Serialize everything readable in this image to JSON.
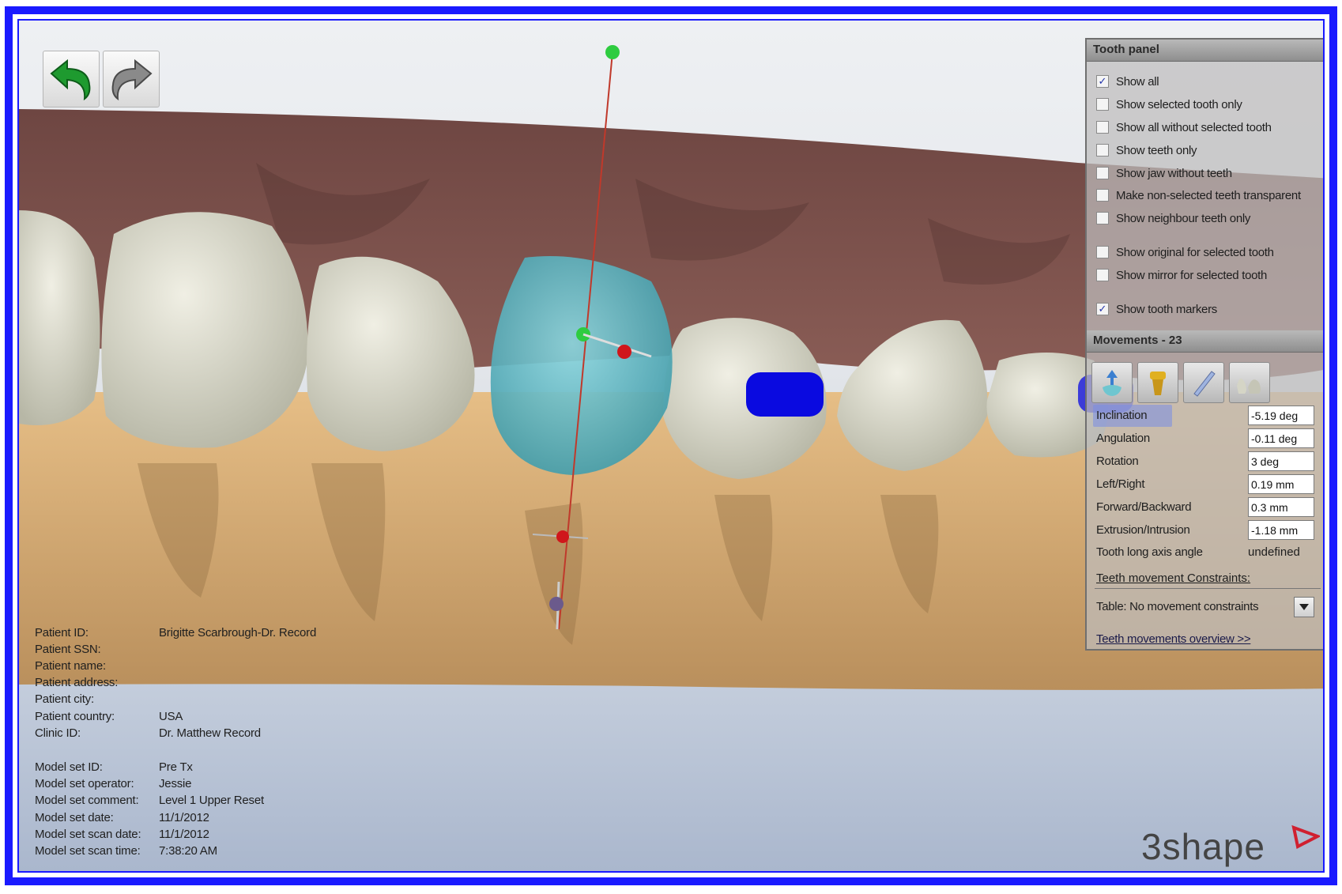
{
  "toolbar": {
    "undo_icon": "undo-arrow-icon",
    "redo_icon": "redo-arrow-icon"
  },
  "tooth_panel": {
    "title": "Tooth panel",
    "options": [
      {
        "label": "Show all",
        "checked": true
      },
      {
        "label": "Show selected tooth only",
        "checked": false
      },
      {
        "label": "Show all without selected tooth",
        "checked": false
      },
      {
        "label": "Show teeth only",
        "checked": false
      },
      {
        "label": "Show jaw without teeth",
        "checked": false
      },
      {
        "label": "Make non-selected teeth transparent",
        "checked": false
      },
      {
        "label": "Show neighbour teeth only",
        "checked": false
      },
      {
        "label": "Show original for selected tooth",
        "checked": false
      },
      {
        "label": "Show mirror for selected tooth",
        "checked": false
      },
      {
        "label": "Show tooth markers",
        "checked": true
      }
    ],
    "check_mark": "✓"
  },
  "movements": {
    "title": "Movements - 23",
    "tools": [
      "move-tooth-icon",
      "implant-icon",
      "ruler-icon",
      "teeth-icon"
    ],
    "fields": [
      {
        "label": "Inclination",
        "value": "-5.19 deg"
      },
      {
        "label": "Angulation",
        "value": "-0.11 deg"
      },
      {
        "label": "Rotation",
        "value": "3 deg"
      },
      {
        "label": "Left/Right",
        "value": "0.19 mm"
      },
      {
        "label": "Forward/Backward",
        "value": "0.3 mm"
      },
      {
        "label": "Extrusion/Intrusion",
        "value": "-1.18 mm"
      }
    ],
    "long_axis_label": "Tooth long axis angle",
    "long_axis_value": "undefined",
    "constraints_label": "Teeth movement Constraints:",
    "constraints_table": "Table: No movement constraints",
    "overview_link": "Teeth movements overview >>"
  },
  "patient_info": {
    "rows": [
      {
        "label": "Patient ID:",
        "value": "Brigitte Scarbrough-Dr. Record"
      },
      {
        "label": "Patient SSN:",
        "value": ""
      },
      {
        "label": "Patient name:",
        "value": ""
      },
      {
        "label": "Patient address:",
        "value": ""
      },
      {
        "label": "Patient city:",
        "value": ""
      },
      {
        "label": "Patient country:",
        "value": "USA"
      },
      {
        "label": "Clinic ID:",
        "value": "Dr. Matthew Record"
      }
    ],
    "model_rows": [
      {
        "label": "Model set ID:",
        "value": "Pre Tx"
      },
      {
        "label": "Model set operator:",
        "value": "Jessie"
      },
      {
        "label": "Model set comment:",
        "value": "Level 1 Upper Reset"
      },
      {
        "label": "Model set date:",
        "value": "11/1/2012"
      },
      {
        "label": "Model set scan date:",
        "value": "11/1/2012"
      },
      {
        "label": "Model set scan time:",
        "value": "7:38:20 AM"
      }
    ]
  },
  "logo": {
    "text": "3shape"
  },
  "colors": {
    "frame": "#1a1aff",
    "gum": "#7a4f4a",
    "lower_jaw": "#d8b07a",
    "tooth": "#d8d8c8",
    "selected_tooth": "#5fb8c4",
    "marker": "#0a0ae0"
  }
}
